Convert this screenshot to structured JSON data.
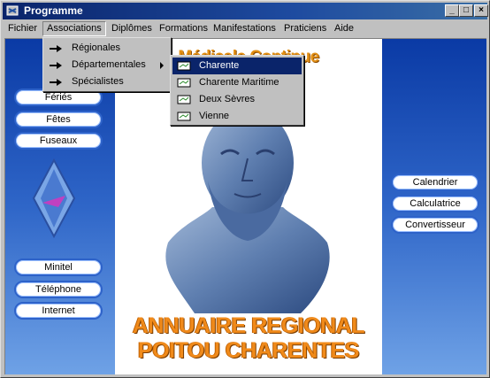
{
  "window": {
    "title": "Programme"
  },
  "menubar": {
    "items": [
      "Fichier",
      "Associations",
      "Diplômes",
      "Formations",
      "Manifestations",
      "Praticiens",
      "Aide"
    ]
  },
  "associations_menu": {
    "items": [
      "Régionales",
      "Départementales",
      "Spécialistes"
    ]
  },
  "departements_menu": {
    "items": [
      "Charente",
      "Charente Maritime",
      "Deux Sèvres",
      "Vienne"
    ]
  },
  "left_buttons_top": [
    "Fériés",
    "Fêtes",
    "Fuseaux"
  ],
  "left_buttons_bottom": [
    "Minitel",
    "Téléphone",
    "Internet"
  ],
  "right_buttons": [
    "Calendrier",
    "Calculatrice",
    "Convertisseur"
  ],
  "banner": {
    "title": "Médicale Continue",
    "line1": "ANNUAIRE REGIONAL",
    "line2": "POITOU CHARENTES"
  },
  "colors": {
    "titlebar": "#0a246a",
    "selection": "#0a246a",
    "accent": "#e28f14",
    "background": "#0f3f9e"
  }
}
